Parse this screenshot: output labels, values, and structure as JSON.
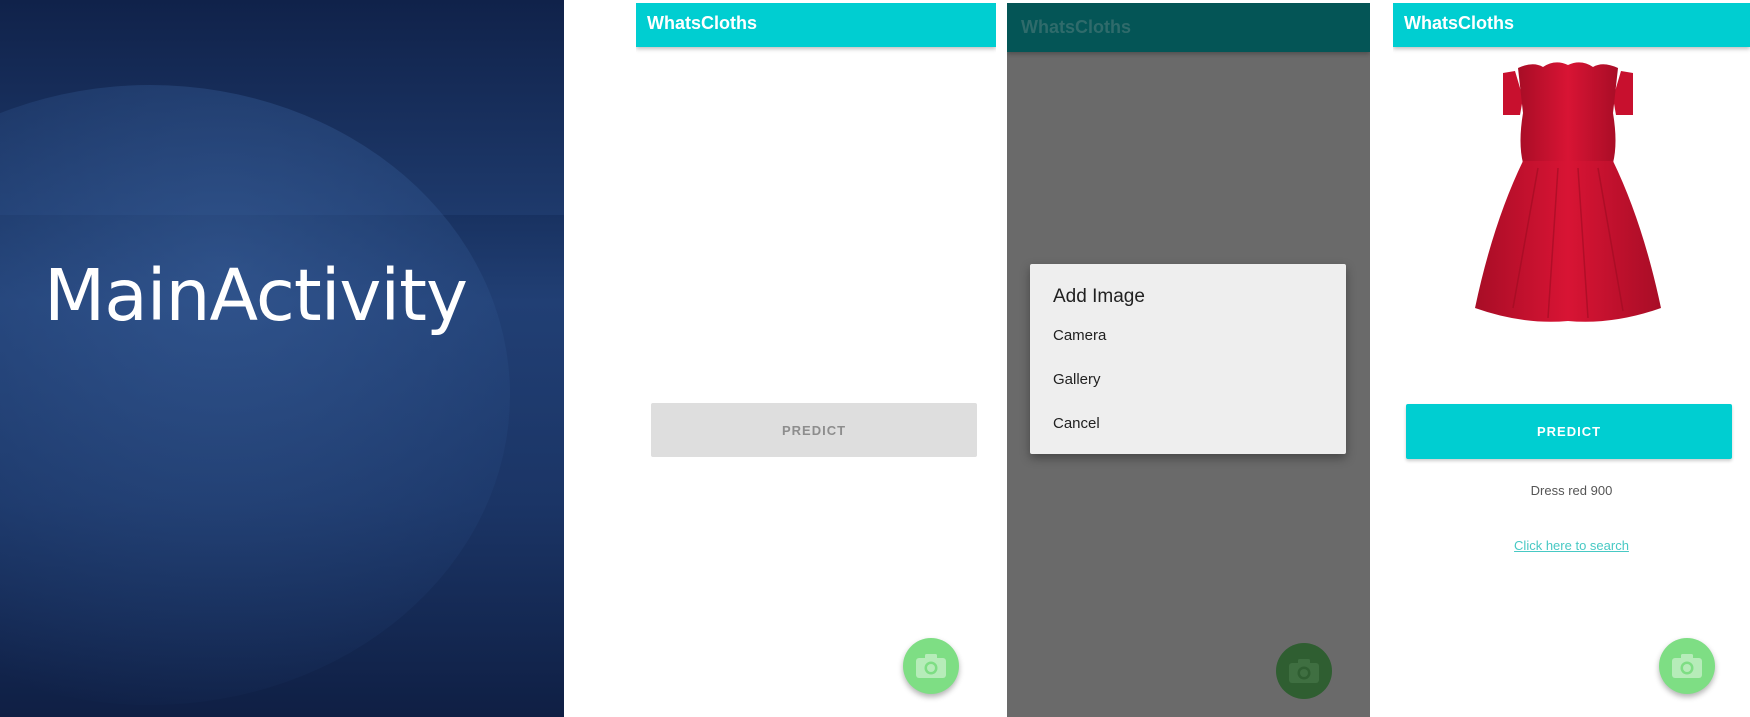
{
  "slide": {
    "title": "MainActivity"
  },
  "screens": {
    "empty": {
      "app_title": "WhatsCloths",
      "predict_label": "PREDICT"
    },
    "dialog": {
      "app_title": "WhatsCloths",
      "dialog_title": "Add Image",
      "options": [
        "Camera",
        "Gallery",
        "Cancel"
      ]
    },
    "result": {
      "app_title": "WhatsCloths",
      "predict_label": "PREDICT",
      "prediction_text": "Dress red 900",
      "search_link": "Click here to search"
    }
  },
  "icons": {
    "fab": "camera-icon",
    "image": "red-dress-image"
  },
  "colors": {
    "accent": "#00ced1",
    "fab": "#7ede84",
    "dress": "#c8102e"
  }
}
